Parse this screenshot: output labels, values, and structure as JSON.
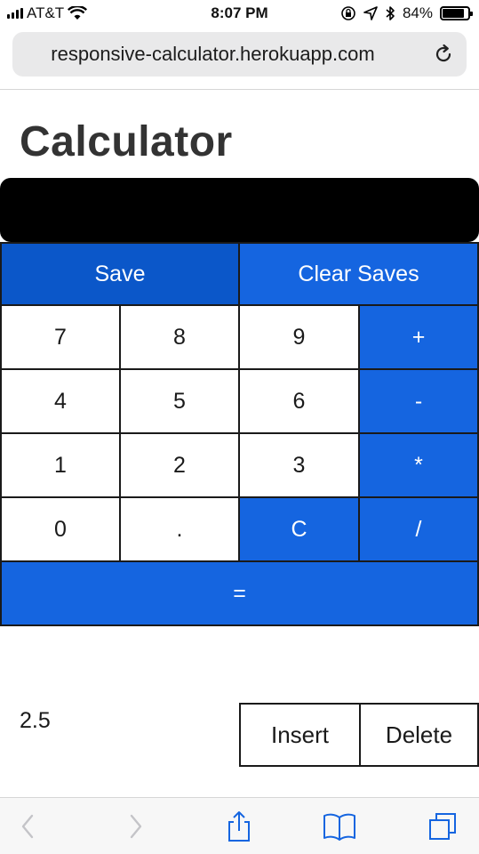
{
  "status_bar": {
    "carrier": "AT&T",
    "time": "8:07 PM",
    "battery": "84%",
    "battery_level": 0.84
  },
  "browser": {
    "url": "responsive-calculator.herokuapp.com"
  },
  "page": {
    "title": "Calculator",
    "display_value": ""
  },
  "controls": {
    "save_label": "Save",
    "clear_saves_label": "Clear Saves"
  },
  "keypad": {
    "k7": "7",
    "k8": "8",
    "k9": "9",
    "plus": "+",
    "k4": "4",
    "k5": "5",
    "k6": "6",
    "minus": "-",
    "k1": "1",
    "k2": "2",
    "k3": "3",
    "multiply": "*",
    "k0": "0",
    "dot": ".",
    "clear": "C",
    "divide": "/",
    "equals": "="
  },
  "saves": {
    "items": [
      {
        "value": "2.5",
        "insert_label": "Insert",
        "delete_label": "Delete"
      }
    ]
  },
  "colors": {
    "accent": "#1565e0",
    "accent_dark": "#0b57c9",
    "display_bg": "#000000"
  }
}
